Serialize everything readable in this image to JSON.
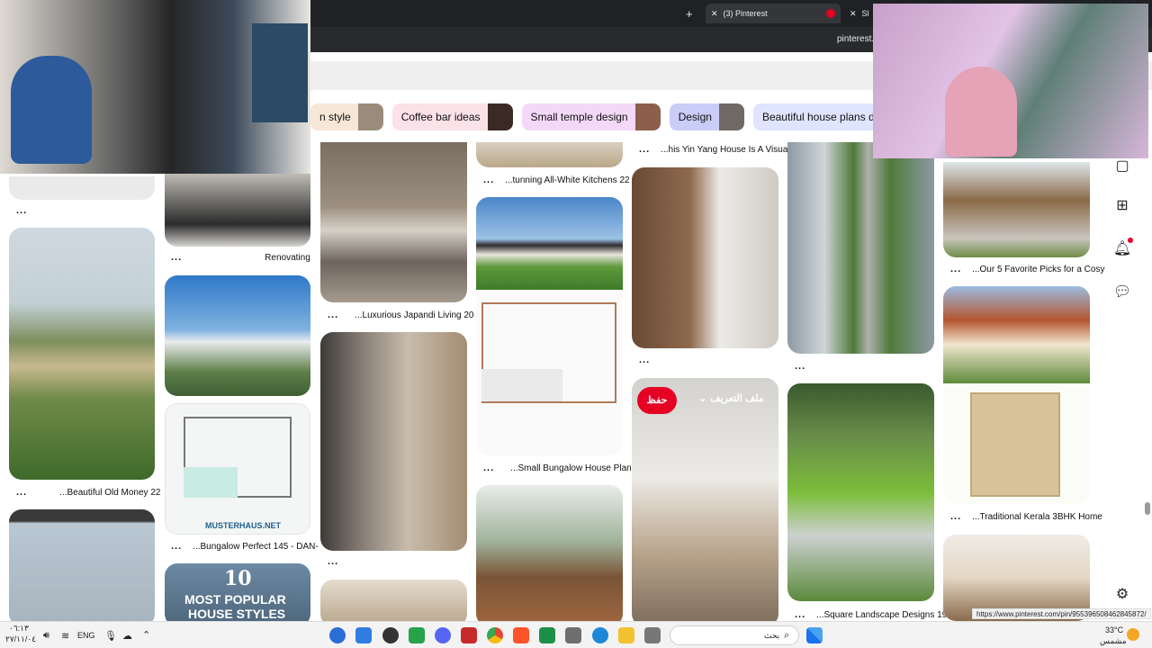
{
  "browser": {
    "new_tab_symbol": "+",
    "close_symbol": "✕",
    "active_tab_title": "(3) Pinterest",
    "next_tab_partial": "Sl",
    "url_partial": "pinterest."
  },
  "pills": [
    {
      "label": "n style",
      "bg": "#f7e7d7",
      "thumb": "#9a8b7a"
    },
    {
      "label": "Coffee bar ideas",
      "bg": "#fbe1e8",
      "thumb": "#3b2a24"
    },
    {
      "label": "Small temple design",
      "bg": "#f3d9f7",
      "thumb": "#8c5f4b"
    },
    {
      "label": "Design",
      "bg": "#c9cdf7",
      "thumb": "#6f6a64"
    },
    {
      "label": "Beautiful house plans dream",
      "bg": "#dfe4ff",
      "thumb": "#7b6a52"
    }
  ],
  "captions": {
    "c1": "Renovating",
    "c2": "...Beautiful Old Money 22",
    "c3": "...Bungalow Perfect 145 - DAN-",
    "c4": "...Luxurious Japandi Living 20",
    "c5": "...tunning All-White Kitchens 22",
    "c6": "...Small Bungalow House Plan",
    "c7": "...his Yin Yang House Is A Visual",
    "c8": "...Square Landscape Designs 19",
    "c9": "...Our 5 Favorite Picks for a Cosy",
    "c10": "...Traditional Kerala 3BHK Home",
    "more": "..."
  },
  "pin_overlay": {
    "save_label": "حفظ",
    "profile_label": "ملف التعريف"
  },
  "pin_text": {
    "musterhaus": "MUSTERHAUS.NET",
    "most_popular_num": "10",
    "most_popular": "MOST POPULAR",
    "house_styles": "HOUSE STYLES"
  },
  "status_url": "https://www.pinterest.com/pin/955396508462845872/",
  "taskbar": {
    "date": "٢٧/١١/٠٤",
    "time": "٠٦:١٣",
    "lang": "ENG",
    "search_placeholder": "بحث",
    "weather_temp": "33°C",
    "weather_desc": "مشمس"
  },
  "colors": {
    "pin_red": "#e60023",
    "browser_bg": "#202124"
  }
}
